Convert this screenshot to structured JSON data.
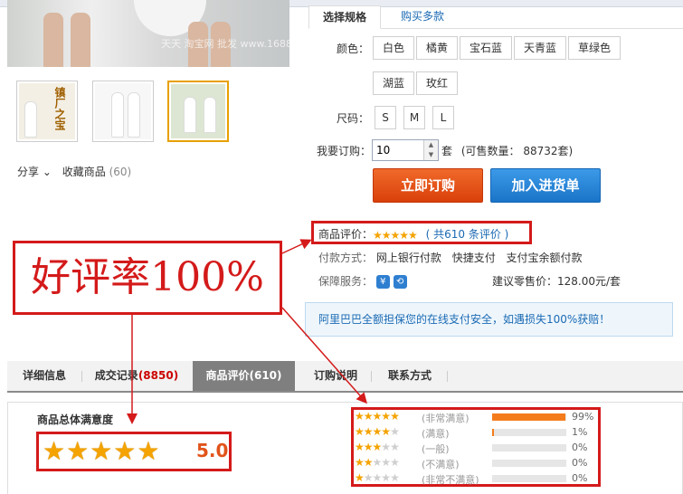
{
  "spec_tabs": {
    "active": "选择规格",
    "other": "购买多款"
  },
  "image_watermark": "天天 淘宝网 批发 www.1688.com",
  "thumbnails": [
    {
      "label": "镇厂之宝"
    },
    {
      "label": ""
    },
    {
      "label": ""
    }
  ],
  "share": {
    "share_label": "分享",
    "fav_label": "收藏商品",
    "fav_count": "(60)"
  },
  "color": {
    "label": "颜色：",
    "options": [
      "白色",
      "橘黄",
      "宝石蓝",
      "天青蓝",
      "草绿色",
      "湖蓝",
      "玫红"
    ]
  },
  "size": {
    "label": "尺码：",
    "options": [
      "S",
      "M",
      "L"
    ]
  },
  "quantity": {
    "label": "我要订购：",
    "value": "10",
    "unit": "套",
    "available": "(可售数量： 88732套)"
  },
  "buttons": {
    "order": "立即订购",
    "cart": "加入进货单"
  },
  "review": {
    "label": "商品评价：",
    "link": "( 共610 条评价 )"
  },
  "payment": {
    "label": "付款方式：",
    "methods": [
      "网上银行付款",
      "快捷支付",
      "支付宝余额付款"
    ]
  },
  "guarantee": {
    "label": "保障服务：",
    "icons": [
      "yen-shield-icon",
      "return-shield-icon"
    ],
    "retail": "建议零售价：",
    "retail_price": "128.00元/套"
  },
  "secure_notice": "阿里巴巴全额担保您的在线支付安全，如遇损失100%获赔！",
  "annotation": {
    "text": "好评率100%"
  },
  "bottom_tabs": [
    {
      "label": "详细信息",
      "num": ""
    },
    {
      "label": "成交记录",
      "num": "(8850)"
    },
    {
      "label": "商品评价(610)",
      "num": ""
    },
    {
      "label": "订购说明",
      "num": ""
    },
    {
      "label": "联系方式",
      "num": ""
    }
  ],
  "satisfaction": {
    "title": "商品总体满意度",
    "score": "5.0",
    "stars": 5
  },
  "breakdown": [
    {
      "stars": 5,
      "label": "(非常满意)",
      "percent": "99%",
      "fraction": 0.99
    },
    {
      "stars": 4,
      "label": "(满意)",
      "percent": "1%",
      "fraction": 0.01
    },
    {
      "stars": 3,
      "label": "(一般)",
      "percent": "0%",
      "fraction": 0
    },
    {
      "stars": 2,
      "label": "(不满意)",
      "percent": "0%",
      "fraction": 0
    },
    {
      "stars": 1,
      "label": "(非常不满意)",
      "percent": "0%",
      "fraction": 0
    }
  ],
  "colors": {
    "accent_orange": "#e1531a",
    "accent_blue": "#1b6ab3",
    "annotation_red": "#d41a1a",
    "star": "#f4a300"
  }
}
